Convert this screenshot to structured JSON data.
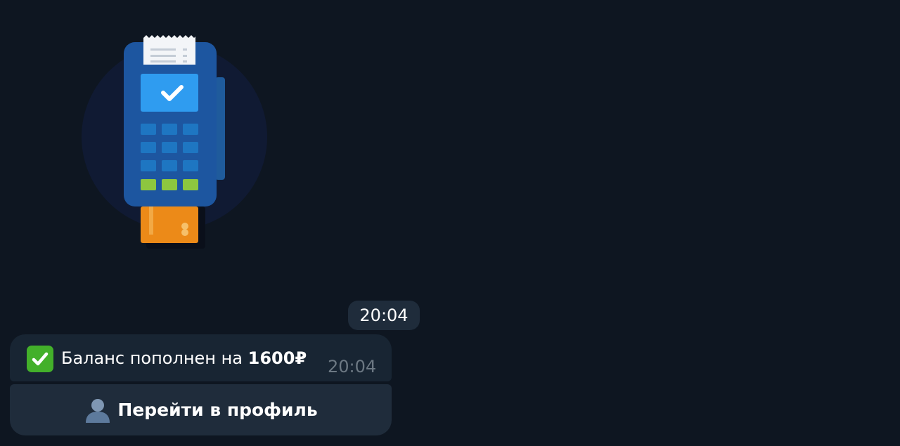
{
  "sticker": {
    "icon": "payment-terminal-icon"
  },
  "date_badge": {
    "time": "20:04"
  },
  "message": {
    "status_icon": "check-mark-button-icon",
    "text_prefix": "Баланс пополнен на",
    "amount": "1600₽",
    "time": "20:04"
  },
  "inline_keyboard": {
    "button_icon": "bust-in-silhouette-icon",
    "button_label": "Перейти в профиль"
  },
  "colors": {
    "background": "#0e1621",
    "bubble": "#182533",
    "button": "#1f2c3b",
    "muted_time": "#6c7883"
  }
}
